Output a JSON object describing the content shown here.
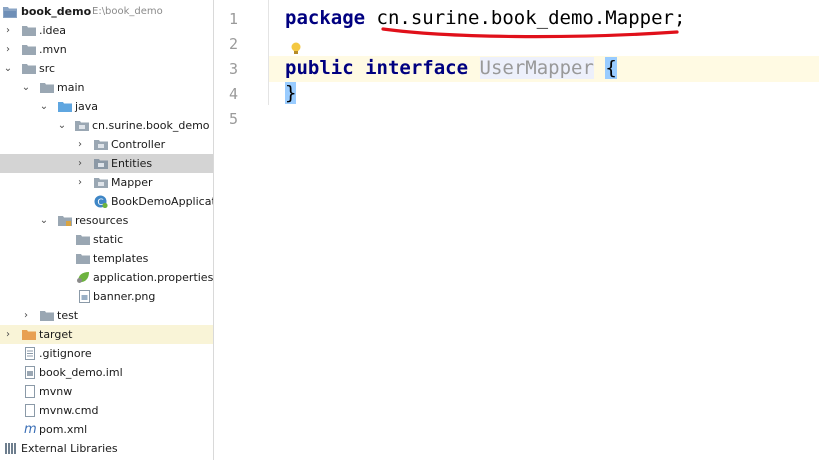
{
  "project_tree": {
    "root": {
      "name": "book_demo",
      "path": "E:\\book_demo"
    },
    "items": [
      {
        "label": "book_demo",
        "icon": "module-folder-icon"
      },
      {
        "label": ".idea",
        "icon": "folder-icon"
      },
      {
        "label": ".mvn",
        "icon": "folder-icon"
      },
      {
        "label": "src",
        "icon": "folder-icon"
      },
      {
        "label": "main",
        "icon": "folder-icon"
      },
      {
        "label": "java",
        "icon": "source-folder-icon"
      },
      {
        "label": "cn.surine.book_demo",
        "icon": "package-icon"
      },
      {
        "label": "Controller",
        "icon": "package-icon"
      },
      {
        "label": "Entities",
        "icon": "package-icon"
      },
      {
        "label": "Mapper",
        "icon": "package-icon"
      },
      {
        "label": "BookDemoApplicat",
        "icon": "spring-boot-class-icon"
      },
      {
        "label": "resources",
        "icon": "resources-folder-icon"
      },
      {
        "label": "static",
        "icon": "folder-icon"
      },
      {
        "label": "templates",
        "icon": "folder-icon"
      },
      {
        "label": "application.properties",
        "icon": "spring-properties-icon"
      },
      {
        "label": "banner.png",
        "icon": "image-file-icon"
      },
      {
        "label": "test",
        "icon": "folder-icon"
      },
      {
        "label": "target",
        "icon": "excluded-folder-icon"
      },
      {
        "label": ".gitignore",
        "icon": "text-file-icon"
      },
      {
        "label": "book_demo.iml",
        "icon": "iml-file-icon"
      },
      {
        "label": "mvnw",
        "icon": "file-icon"
      },
      {
        "label": "mvnw.cmd",
        "icon": "file-icon"
      },
      {
        "label": "pom.xml",
        "icon": "maven-icon"
      },
      {
        "label": "External Libraries",
        "icon": "libraries-icon"
      }
    ]
  },
  "editor": {
    "line_numbers": [
      "1",
      "2",
      "3",
      "4",
      "5"
    ],
    "line1": {
      "keyword": "package",
      "package_name": "cn.surine.book_demo.Mapper",
      "semicolon": ";"
    },
    "line3": {
      "kw1": "public",
      "kw2": "interface",
      "type_name": "UserMapper",
      "open_brace": "{"
    },
    "line4": {
      "close_brace": "}"
    }
  },
  "colors": {
    "keyword": "#000080",
    "unused_identifier": "#999999",
    "caret_row": "#fffae3",
    "selected_row": "#d4d4d4",
    "excluded_row": "#f9f4d7",
    "annotation_underline": "#e0101a"
  }
}
